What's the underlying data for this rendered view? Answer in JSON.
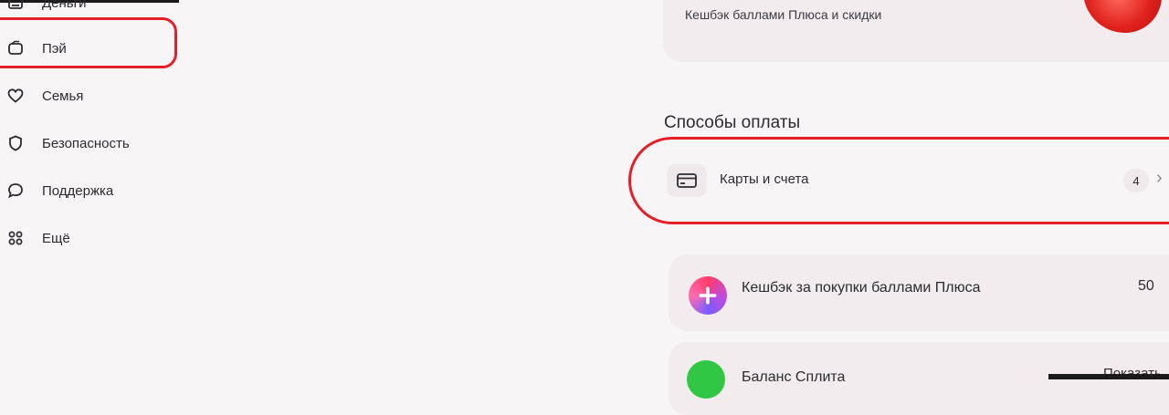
{
  "sidebar": {
    "items": [
      {
        "label": "Деньги",
        "icon": "wallet-icon"
      },
      {
        "label": "Пэй",
        "icon": "pay-icon"
      },
      {
        "label": "Семья",
        "icon": "heart-icon"
      },
      {
        "label": "Безопасность",
        "icon": "shield-icon"
      },
      {
        "label": "Поддержка",
        "icon": "chat-icon"
      },
      {
        "label": "Ещё",
        "icon": "grid-icon"
      }
    ]
  },
  "top_card": {
    "subtitle": "Кешбэк баллами Плюса и скидки"
  },
  "payment_methods": {
    "title": "Способы оплаты",
    "cards_row": {
      "label": "Карты и счета",
      "count": "4",
      "icon": "card-icon"
    }
  },
  "cashback_card": {
    "label": "Кешбэк за покупки баллами Плюса",
    "value": "50",
    "icon": "plus-icon"
  },
  "balance_card": {
    "label": "Баланс Сплита",
    "action": "Показать",
    "icon": "split-icon"
  },
  "colors": {
    "accent_red": "#e41f2a",
    "background": "#f8f5f7",
    "card_bg": "#f3ecef"
  }
}
